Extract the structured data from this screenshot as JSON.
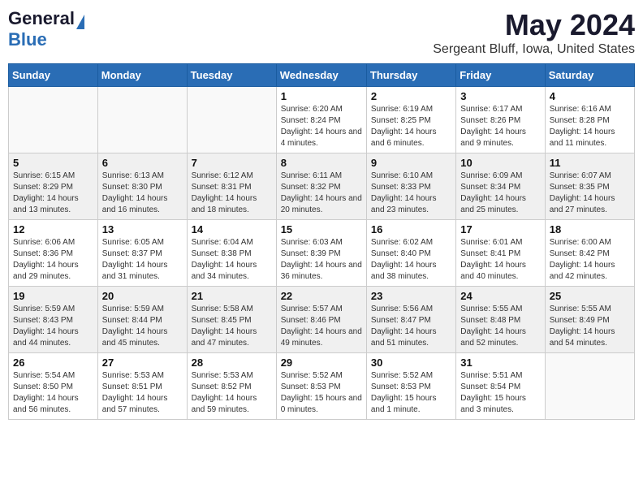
{
  "header": {
    "logo_general": "General",
    "logo_blue": "Blue",
    "title": "May 2024",
    "subtitle": "Sergeant Bluff, Iowa, United States"
  },
  "days_of_week": [
    "Sunday",
    "Monday",
    "Tuesday",
    "Wednesday",
    "Thursday",
    "Friday",
    "Saturday"
  ],
  "weeks": [
    [
      {
        "day": "",
        "sunrise": "",
        "sunset": "",
        "daylight": ""
      },
      {
        "day": "",
        "sunrise": "",
        "sunset": "",
        "daylight": ""
      },
      {
        "day": "",
        "sunrise": "",
        "sunset": "",
        "daylight": ""
      },
      {
        "day": "1",
        "sunrise": "Sunrise: 6:20 AM",
        "sunset": "Sunset: 8:24 PM",
        "daylight": "Daylight: 14 hours and 4 minutes."
      },
      {
        "day": "2",
        "sunrise": "Sunrise: 6:19 AM",
        "sunset": "Sunset: 8:25 PM",
        "daylight": "Daylight: 14 hours and 6 minutes."
      },
      {
        "day": "3",
        "sunrise": "Sunrise: 6:17 AM",
        "sunset": "Sunset: 8:26 PM",
        "daylight": "Daylight: 14 hours and 9 minutes."
      },
      {
        "day": "4",
        "sunrise": "Sunrise: 6:16 AM",
        "sunset": "Sunset: 8:28 PM",
        "daylight": "Daylight: 14 hours and 11 minutes."
      }
    ],
    [
      {
        "day": "5",
        "sunrise": "Sunrise: 6:15 AM",
        "sunset": "Sunset: 8:29 PM",
        "daylight": "Daylight: 14 hours and 13 minutes."
      },
      {
        "day": "6",
        "sunrise": "Sunrise: 6:13 AM",
        "sunset": "Sunset: 8:30 PM",
        "daylight": "Daylight: 14 hours and 16 minutes."
      },
      {
        "day": "7",
        "sunrise": "Sunrise: 6:12 AM",
        "sunset": "Sunset: 8:31 PM",
        "daylight": "Daylight: 14 hours and 18 minutes."
      },
      {
        "day": "8",
        "sunrise": "Sunrise: 6:11 AM",
        "sunset": "Sunset: 8:32 PM",
        "daylight": "Daylight: 14 hours and 20 minutes."
      },
      {
        "day": "9",
        "sunrise": "Sunrise: 6:10 AM",
        "sunset": "Sunset: 8:33 PM",
        "daylight": "Daylight: 14 hours and 23 minutes."
      },
      {
        "day": "10",
        "sunrise": "Sunrise: 6:09 AM",
        "sunset": "Sunset: 8:34 PM",
        "daylight": "Daylight: 14 hours and 25 minutes."
      },
      {
        "day": "11",
        "sunrise": "Sunrise: 6:07 AM",
        "sunset": "Sunset: 8:35 PM",
        "daylight": "Daylight: 14 hours and 27 minutes."
      }
    ],
    [
      {
        "day": "12",
        "sunrise": "Sunrise: 6:06 AM",
        "sunset": "Sunset: 8:36 PM",
        "daylight": "Daylight: 14 hours and 29 minutes."
      },
      {
        "day": "13",
        "sunrise": "Sunrise: 6:05 AM",
        "sunset": "Sunset: 8:37 PM",
        "daylight": "Daylight: 14 hours and 31 minutes."
      },
      {
        "day": "14",
        "sunrise": "Sunrise: 6:04 AM",
        "sunset": "Sunset: 8:38 PM",
        "daylight": "Daylight: 14 hours and 34 minutes."
      },
      {
        "day": "15",
        "sunrise": "Sunrise: 6:03 AM",
        "sunset": "Sunset: 8:39 PM",
        "daylight": "Daylight: 14 hours and 36 minutes."
      },
      {
        "day": "16",
        "sunrise": "Sunrise: 6:02 AM",
        "sunset": "Sunset: 8:40 PM",
        "daylight": "Daylight: 14 hours and 38 minutes."
      },
      {
        "day": "17",
        "sunrise": "Sunrise: 6:01 AM",
        "sunset": "Sunset: 8:41 PM",
        "daylight": "Daylight: 14 hours and 40 minutes."
      },
      {
        "day": "18",
        "sunrise": "Sunrise: 6:00 AM",
        "sunset": "Sunset: 8:42 PM",
        "daylight": "Daylight: 14 hours and 42 minutes."
      }
    ],
    [
      {
        "day": "19",
        "sunrise": "Sunrise: 5:59 AM",
        "sunset": "Sunset: 8:43 PM",
        "daylight": "Daylight: 14 hours and 44 minutes."
      },
      {
        "day": "20",
        "sunrise": "Sunrise: 5:59 AM",
        "sunset": "Sunset: 8:44 PM",
        "daylight": "Daylight: 14 hours and 45 minutes."
      },
      {
        "day": "21",
        "sunrise": "Sunrise: 5:58 AM",
        "sunset": "Sunset: 8:45 PM",
        "daylight": "Daylight: 14 hours and 47 minutes."
      },
      {
        "day": "22",
        "sunrise": "Sunrise: 5:57 AM",
        "sunset": "Sunset: 8:46 PM",
        "daylight": "Daylight: 14 hours and 49 minutes."
      },
      {
        "day": "23",
        "sunrise": "Sunrise: 5:56 AM",
        "sunset": "Sunset: 8:47 PM",
        "daylight": "Daylight: 14 hours and 51 minutes."
      },
      {
        "day": "24",
        "sunrise": "Sunrise: 5:55 AM",
        "sunset": "Sunset: 8:48 PM",
        "daylight": "Daylight: 14 hours and 52 minutes."
      },
      {
        "day": "25",
        "sunrise": "Sunrise: 5:55 AM",
        "sunset": "Sunset: 8:49 PM",
        "daylight": "Daylight: 14 hours and 54 minutes."
      }
    ],
    [
      {
        "day": "26",
        "sunrise": "Sunrise: 5:54 AM",
        "sunset": "Sunset: 8:50 PM",
        "daylight": "Daylight: 14 hours and 56 minutes."
      },
      {
        "day": "27",
        "sunrise": "Sunrise: 5:53 AM",
        "sunset": "Sunset: 8:51 PM",
        "daylight": "Daylight: 14 hours and 57 minutes."
      },
      {
        "day": "28",
        "sunrise": "Sunrise: 5:53 AM",
        "sunset": "Sunset: 8:52 PM",
        "daylight": "Daylight: 14 hours and 59 minutes."
      },
      {
        "day": "29",
        "sunrise": "Sunrise: 5:52 AM",
        "sunset": "Sunset: 8:53 PM",
        "daylight": "Daylight: 15 hours and 0 minutes."
      },
      {
        "day": "30",
        "sunrise": "Sunrise: 5:52 AM",
        "sunset": "Sunset: 8:53 PM",
        "daylight": "Daylight: 15 hours and 1 minute."
      },
      {
        "day": "31",
        "sunrise": "Sunrise: 5:51 AM",
        "sunset": "Sunset: 8:54 PM",
        "daylight": "Daylight: 15 hours and 3 minutes."
      },
      {
        "day": "",
        "sunrise": "",
        "sunset": "",
        "daylight": ""
      }
    ]
  ]
}
